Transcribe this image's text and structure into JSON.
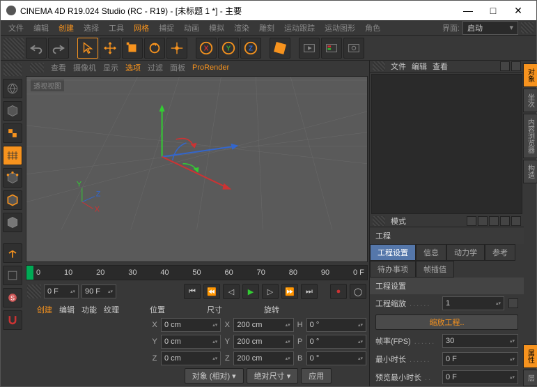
{
  "title": "CINEMA 4D R19.024 Studio (RC - R19) - [未标题 1 *] - 主要",
  "menubar": [
    "文件",
    "编辑",
    "创建",
    "选择",
    "工具",
    "网格",
    "捕捉",
    "动画",
    "模拟",
    "渲染",
    "雕刻",
    "运动跟踪",
    "运动图形",
    "角色"
  ],
  "menubar_hl": [
    2,
    5
  ],
  "interface_lbl": "界面:",
  "interface_val": "启动",
  "vpmenu": [
    "查看",
    "摄像机",
    "显示",
    "选项",
    "过滤",
    "面板",
    "ProRender"
  ],
  "vpmenu_hl": [
    3,
    6
  ],
  "vplabel": "透视视图",
  "timeline_ticks": [
    "0",
    "10",
    "20",
    "30",
    "40",
    "50",
    "60",
    "70",
    "80",
    "90",
    "0 F"
  ],
  "frame_start": "0 F",
  "frame_end": "90 F",
  "coord_tabs": [
    "创建",
    "编辑",
    "功能",
    "纹理"
  ],
  "coord_hdr": [
    "位置",
    "尺寸",
    "旋转"
  ],
  "coord": {
    "X": {
      "pos": "0 cm",
      "size": "200 cm",
      "rot_lbl": "H",
      "rot": "0 °"
    },
    "Y": {
      "pos": "0 cm",
      "size": "200 cm",
      "rot_lbl": "P",
      "rot": "0 °"
    },
    "Z": {
      "pos": "0 cm",
      "size": "200 cm",
      "rot_lbl": "B",
      "rot": "0 °"
    }
  },
  "coord_btn1": "对象 (相对)",
  "coord_btn2": "绝对尺寸",
  "coord_btn3": "应用",
  "objpanel_menu": [
    "文件",
    "编辑",
    "查看"
  ],
  "mode_lbl": "模式",
  "prop_title": "工程",
  "prop_tabs": [
    "工程设置",
    "信息",
    "动力学",
    "参考"
  ],
  "prop_tabs2": [
    "待办事项",
    "帧插值"
  ],
  "prop_section": "工程设置",
  "prop_scale_lbl": "工程缩放",
  "prop_scale_val": "1",
  "prop_scale_btn": "缩放工程..",
  "prop_fps_lbl": "帧率(FPS)",
  "prop_fps_val": "30",
  "prop_mintime_lbl": "最小时长",
  "prop_mintime_val": "0 F",
  "prop_prevmin_lbl": "预览最小时长",
  "prop_prevmin_val": "0 F",
  "sidetabs": [
    "对象",
    "坐次",
    "内容浏览器",
    "构造"
  ],
  "sidetabs2": [
    "属性",
    "层"
  ]
}
